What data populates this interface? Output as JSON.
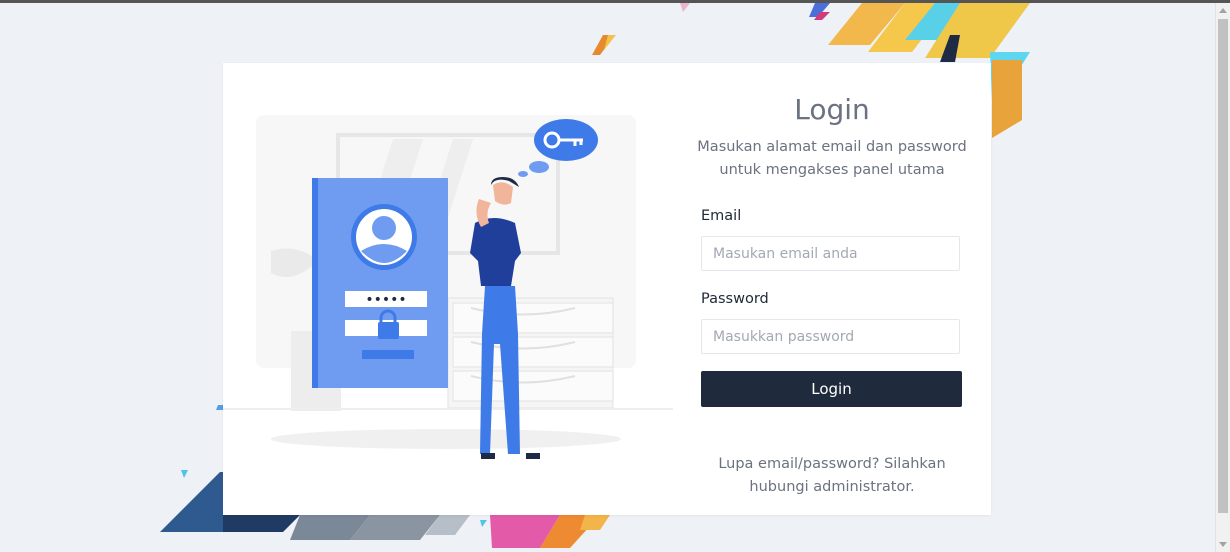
{
  "login": {
    "title": "Login",
    "subtitle": "Masukan alamat email dan password untuk mengakses panel utama",
    "email_label": "Email",
    "email_placeholder": "Masukan email anda",
    "email_value": "",
    "password_label": "Password",
    "password_placeholder": "Masukkan password",
    "password_value": "",
    "submit_label": "Login",
    "help_text": "Lupa email/password? Silahkan hubungi administrator."
  },
  "illustration": {
    "password_mask": "•••••"
  },
  "colors": {
    "page_bg": "#eef1f5",
    "card_bg": "#ffffff",
    "primary_button": "#1f2a3c",
    "illustration_blue": "#3f7be8"
  }
}
